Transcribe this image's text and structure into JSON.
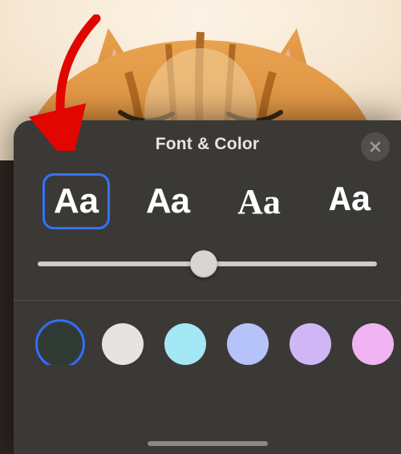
{
  "sheet": {
    "title": "Font & Color",
    "close_icon": "close"
  },
  "fonts": {
    "sample_text": "Aa",
    "selected_index": 0,
    "options": [
      {
        "name": "sans-bold"
      },
      {
        "name": "rounded"
      },
      {
        "name": "serif"
      },
      {
        "name": "typewriter"
      }
    ]
  },
  "size_slider": {
    "min": 0,
    "max": 100,
    "value": 49
  },
  "colors": {
    "selected_index": 0,
    "options": [
      {
        "name": "dark",
        "hex": "#2f3a34"
      },
      {
        "name": "white",
        "hex": "#e6e4e1"
      },
      {
        "name": "light-cyan",
        "hex": "#a4e7f5"
      },
      {
        "name": "periwinkle",
        "hex": "#b5c3f8"
      },
      {
        "name": "lavender",
        "hex": "#cfb7f6"
      },
      {
        "name": "pink",
        "hex": "#f0b4f2"
      }
    ]
  },
  "annotation": {
    "arrow_target": "font-option-0"
  }
}
